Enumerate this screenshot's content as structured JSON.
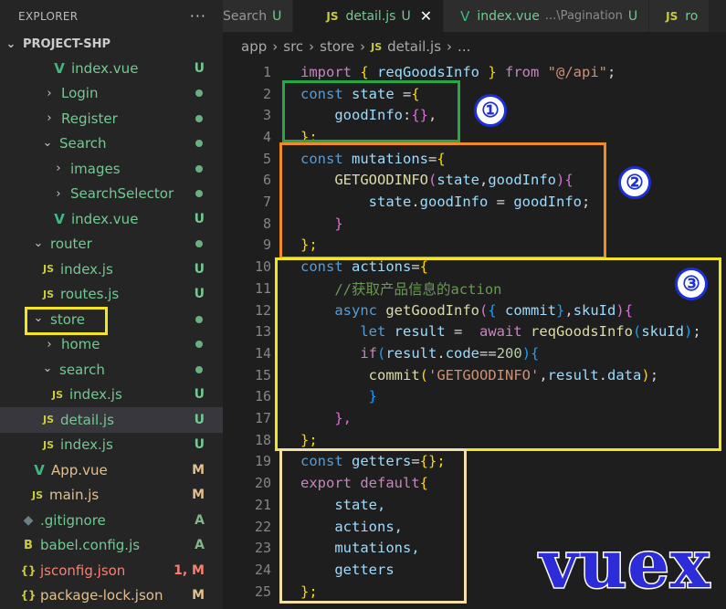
{
  "sidebar": {
    "title": "EXPLORER",
    "more": "···",
    "project": "PROJECT-SHP",
    "items": [
      {
        "label": "index.vue",
        "icon": "vue-icon",
        "glyph": "V",
        "status": "U"
      },
      {
        "label": "Login",
        "chevron": "›",
        "status": "●"
      },
      {
        "label": "Register",
        "chevron": "›",
        "status": "●"
      },
      {
        "label": "Search",
        "chevron": "⌄",
        "status": "●"
      },
      {
        "label": "images",
        "chevron": "›",
        "status": "●"
      },
      {
        "label": "SearchSelector",
        "chevron": "›",
        "status": "●"
      },
      {
        "label": "index.vue",
        "icon": "vue-icon",
        "glyph": "V",
        "status": "U"
      },
      {
        "label": "router",
        "chevron": "⌄",
        "status": "●"
      },
      {
        "label": "index.js",
        "icon": "js-icon",
        "glyph": "JS",
        "status": "U"
      },
      {
        "label": "routes.js",
        "icon": "js-icon",
        "glyph": "JS",
        "status": "U"
      },
      {
        "label": "store",
        "chevron": "⌄",
        "status": "●"
      },
      {
        "label": "home",
        "chevron": "›",
        "status": "●"
      },
      {
        "label": "search",
        "chevron": "⌄",
        "status": "●"
      },
      {
        "label": "index.js",
        "icon": "js-icon",
        "glyph": "JS",
        "status": "U"
      },
      {
        "label": "detail.js",
        "icon": "js-icon",
        "glyph": "JS",
        "status": "U"
      },
      {
        "label": "index.js",
        "icon": "js-icon",
        "glyph": "JS",
        "status": "U"
      },
      {
        "label": "App.vue",
        "icon": "vue-icon",
        "glyph": "V",
        "status": "M"
      },
      {
        "label": "main.js",
        "icon": "js-icon",
        "glyph": "JS",
        "status": "M"
      },
      {
        "label": ".gitignore",
        "icon": "git-icon",
        "glyph": "◆",
        "status": "A"
      },
      {
        "label": "babel.config.js",
        "icon": "babel-icon",
        "glyph": "B",
        "status": "A"
      },
      {
        "label": "jsconfig.json",
        "icon": "json-icon",
        "glyph": "{}",
        "status": "1, M"
      },
      {
        "label": "package-lock.json",
        "icon": "json-icon",
        "glyph": "{}",
        "status": "M"
      }
    ]
  },
  "tabs": [
    {
      "label": "Search",
      "status": "U"
    },
    {
      "label": "detail.js",
      "icon": "JS",
      "status": "U",
      "close": "✕"
    },
    {
      "label": "index.vue",
      "icon": "V",
      "path": "...\\Pagination",
      "status": "U"
    },
    {
      "label": "ro",
      "icon": "JS"
    }
  ],
  "breadcrumb": {
    "parts": [
      "app",
      "src",
      "store"
    ],
    "file_icon": "JS",
    "file": "detail.js",
    "tail": "...",
    "sep": "›"
  },
  "editor": {
    "line_numbers": [
      "1",
      "2",
      "3",
      "4",
      "5",
      "6",
      "7",
      "8",
      "9",
      "10",
      "11",
      "12",
      "13",
      "14",
      "15",
      "16",
      "17",
      "18",
      "19",
      "20",
      "21",
      "22",
      "23",
      "24",
      "25"
    ],
    "tokens": {
      "import": "import",
      "lb": "{ ",
      "reqGoodsInfo": "reqGoodsInfo",
      "rb": " }",
      "from": " from ",
      "api": "\"@/api\"",
      "semi": ";",
      "const": "const",
      "state": " state ",
      "eq": "=",
      "open": "{",
      "goodInfo": "goodInfo",
      "colon": ":",
      "emptyObj": "{}",
      "comma": ",",
      "closeSemi": "};",
      "mutations": " mutations",
      "GETGOODINFO": "GETGOODINFO",
      "lp": "(",
      "stateArg": "state",
      "commaSep": ",",
      "goodInfoArg": "goodInfo",
      "rp": ")",
      "stateDot": "state",
      "dot": ".",
      "goodInfoProp": "goodInfo",
      "assign": " = ",
      "goodInfoVal": "goodInfo",
      "close": "}",
      "actions": " actions",
      "comment": "//获取产品信息的action",
      "async": "async ",
      "getGoodInfo": "getGoodInfo",
      "commit": " commit",
      "skuId": "skuId",
      "let": "let",
      "result": " result",
      "assign2": " =  ",
      "await": "await ",
      "reqGoodsInfo2": "reqGoodsInfo",
      "skuId2": "skuId",
      "if": "if",
      "resultCode": "result",
      "code": "code",
      "eqeq": "==",
      "n200": "200",
      "commitFn": "commit",
      "GETSTR": "'GETGOODINFO'",
      "resultData": "result",
      "data": "data",
      "closeComma": "},",
      "getters": " getters",
      "emptyObjSemi": "{};",
      "export": "export",
      "default": " default",
      "stateKey": "state,",
      "actionsKey": "actions,",
      "mutationsKey": "mutations,",
      "gettersKey": "getters"
    }
  },
  "annotations": {
    "badge1": "①",
    "badge2": "②",
    "badge3": "③",
    "vuex": "vuex"
  }
}
